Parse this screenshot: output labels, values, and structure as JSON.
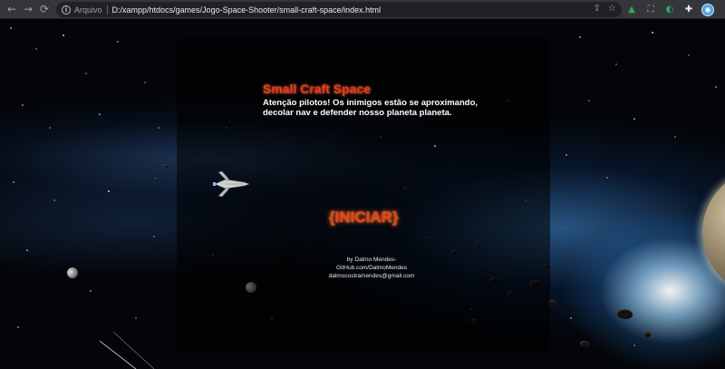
{
  "browser": {
    "security_label": "Arquivo",
    "url": "D:/xampp/htdocs/games/Jogo-Space-Shooter/small-craft-space/index.html",
    "icons": {
      "back": "arrow-left-icon",
      "forward": "arrow-right-icon",
      "reload": "reload-icon",
      "info": "info-icon",
      "share": "share-icon",
      "bookmark": "star-icon",
      "extensions": [
        "green-triangle-extension-icon",
        "grey-extension-icon",
        "teal-extension-icon",
        "puzzle-icon"
      ],
      "profile": "profile-avatar-icon",
      "menu": "kebab-menu-icon"
    }
  },
  "game": {
    "title": "Small Craft Space",
    "intro": "Atenção pilotos! Os inimigos estão se aproximando, decolar nav e defender nosso planeta planeta.",
    "start_label": "{INICIAR}",
    "credits": {
      "line1": "by Dalmo Mendes-",
      "line2": "GitHub.com/DalmoMendes",
      "line3": "dalmocostramendes@gmail.com"
    },
    "colors": {
      "title": "#e53a1f",
      "start": "#d9481e",
      "text": "#ffffff"
    }
  }
}
